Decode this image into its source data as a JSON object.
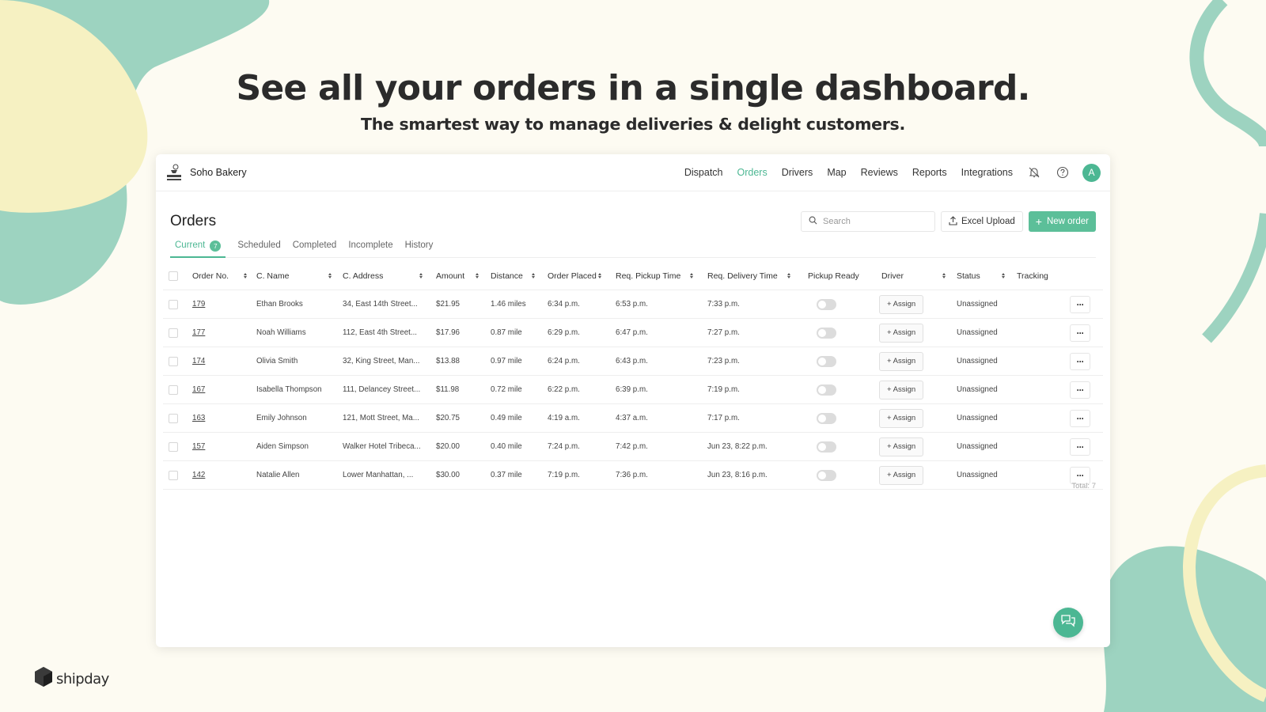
{
  "hero": {
    "title": "See all your orders in a single dashboard.",
    "subtitle": "The smartest way to manage deliveries & delight customers."
  },
  "app": {
    "brand": {
      "name": "Soho Bakery",
      "logo_icon": "soho-bakery-logo"
    },
    "nav": {
      "items": [
        "Dispatch",
        "Orders",
        "Drivers",
        "Map",
        "Reviews",
        "Reports",
        "Integrations"
      ],
      "active": "Orders",
      "icons": [
        "bell-off-icon",
        "help-circle-icon"
      ],
      "avatar": "A"
    },
    "page": {
      "title": "Orders",
      "search_placeholder": "Search",
      "excel_upload": "Excel Upload",
      "new_order": "New order"
    },
    "tabs": [
      {
        "label": "Current",
        "badge": "7",
        "active": true
      },
      {
        "label": "Scheduled"
      },
      {
        "label": "Completed"
      },
      {
        "label": "Incomplete"
      },
      {
        "label": "History"
      }
    ],
    "table": {
      "columns": [
        "Order No.",
        "C. Name",
        "C. Address",
        "Amount",
        "Distance",
        "Order Placed",
        "Req. Pickup Time",
        "Req. Delivery Time",
        "Pickup Ready",
        "Driver",
        "Status",
        "Tracking"
      ],
      "assign_label": "+ Assign",
      "rows": [
        {
          "order": "179",
          "name": "Ethan Brooks",
          "address": "34, East 14th Street...",
          "amount": "$21.95",
          "distance": "1.46 miles",
          "placed": "6:34 p.m.",
          "pickup": "6:53 p.m.",
          "delivery": "7:33 p.m.",
          "status": "Unassigned"
        },
        {
          "order": "177",
          "name": "Noah Williams",
          "address": "112, East 4th Street...",
          "amount": "$17.96",
          "distance": "0.87 mile",
          "placed": "6:29 p.m.",
          "pickup": "6:47 p.m.",
          "delivery": "7:27 p.m.",
          "status": "Unassigned"
        },
        {
          "order": "174",
          "name": "Olivia Smith",
          "address": "32, King Street, Man...",
          "amount": "$13.88",
          "distance": "0.97 mile",
          "placed": "6:24 p.m.",
          "pickup": "6:43 p.m.",
          "delivery": "7:23 p.m.",
          "status": "Unassigned"
        },
        {
          "order": "167",
          "name": "Isabella Thompson",
          "address": "111, Delancey Street...",
          "amount": "$11.98",
          "distance": "0.72 mile",
          "placed": "6:22 p.m.",
          "pickup": "6:39 p.m.",
          "delivery": "7:19 p.m.",
          "status": "Unassigned"
        },
        {
          "order": "163",
          "name": "Emily Johnson",
          "address": "121, Mott Street, Ma...",
          "amount": "$20.75",
          "distance": "0.49 mile",
          "placed": "4:19 a.m.",
          "pickup": "4:37 a.m.",
          "delivery": "7:17 p.m.",
          "status": "Unassigned"
        },
        {
          "order": "157",
          "name": "Aiden Simpson",
          "address": "Walker Hotel Tribeca...",
          "amount": "$20.00",
          "distance": "0.40 mile",
          "placed": "7:24 p.m.",
          "pickup": "7:42 p.m.",
          "delivery": "Jun 23,    8:22 p.m.",
          "status": "Unassigned"
        },
        {
          "order": "142",
          "name": "Natalie Allen",
          "address": "Lower Manhattan, ...",
          "amount": "$30.00",
          "distance": "0.37 mile",
          "placed": "7:19 p.m.",
          "pickup": "7:36 p.m.",
          "delivery": "Jun 23,    8:16 p.m.",
          "status": "Unassigned"
        }
      ],
      "total": "Total: 7"
    },
    "chat_icon": "chat-bubbles-icon"
  },
  "footer": {
    "logo_name": "shipday",
    "logo_icon": "shipday-logo-icon"
  },
  "colors": {
    "accent": "#4cb793",
    "background": "#fdfbf2",
    "blob_green": "#9dd3c0",
    "blob_yellow": "#f6f1c2"
  }
}
